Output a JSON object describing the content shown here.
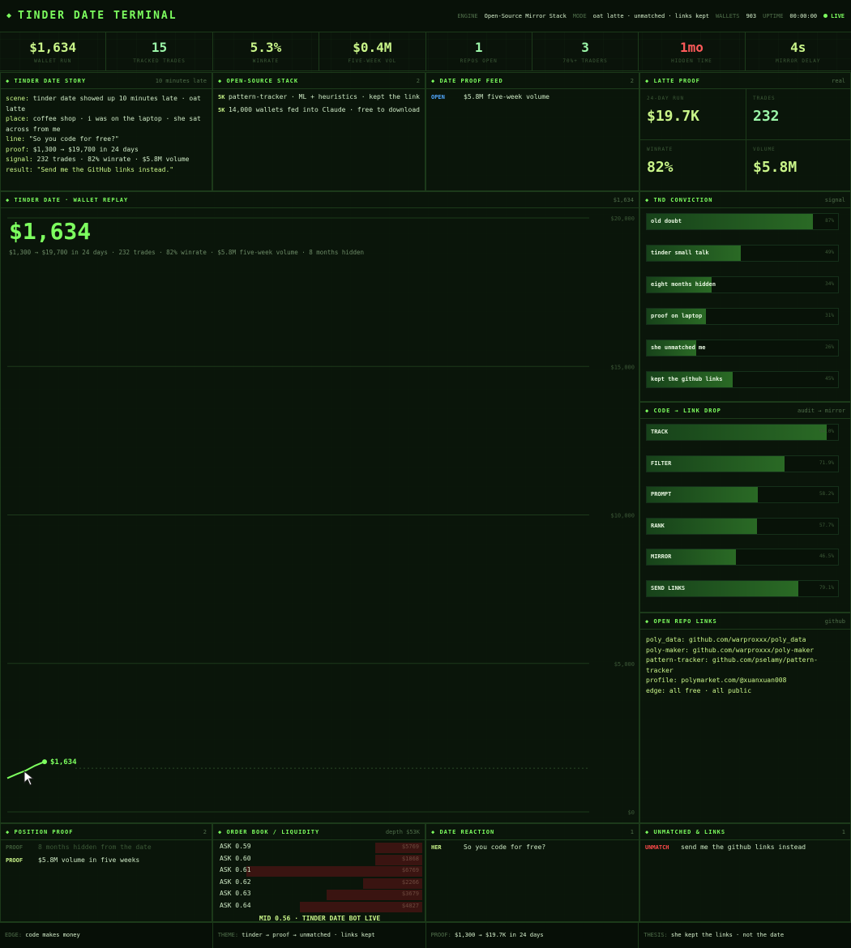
{
  "topbar": {
    "title": "TINDER DATE TERMINAL",
    "engine_label": "ENGINE",
    "engine_value": "Open-Source Mirror Stack",
    "mode_label": "MODE",
    "mode_value": "oat latte · unmatched · links kept",
    "wallets_label": "WALLETS",
    "wallets_value": "903",
    "uptime_label": "UPTIME",
    "uptime_value": "00:00:00",
    "live_label": "LIVE"
  },
  "stats": [
    {
      "value": "$1,634",
      "label": "wallet run",
      "color": "#c9f589"
    },
    {
      "value": "15",
      "label": "tracked trades",
      "color": "#9bf5a8"
    },
    {
      "value": "5.3%",
      "label": "winrate",
      "color": "#c9f589"
    },
    {
      "value": "$0.4M",
      "label": "five-week vol",
      "color": "#c9f589"
    },
    {
      "value": "1",
      "label": "repos open",
      "color": "#9bf5a8"
    },
    {
      "value": "3",
      "label": "70%+ traders",
      "color": "#9bf5a8"
    },
    {
      "value": "1mo",
      "label": "hidden time",
      "color": "#ff5a5a"
    },
    {
      "value": "4s",
      "label": "mirror delay",
      "color": "#c9f589"
    }
  ],
  "story": {
    "title": "TINDER DATE STORY",
    "meta": "10 minutes late",
    "lines": [
      {
        "k": "scene:",
        "v": "tinder date showed up 10 minutes late · oat latte"
      },
      {
        "k": "place:",
        "v": "coffee shop · i was on the laptop · she sat across from me"
      },
      {
        "k": "line:",
        "v": "\"So you code for free?\""
      },
      {
        "k": "proof:",
        "v": "$1,300 → $19,700 in 24 days"
      },
      {
        "k": "signal:",
        "v": "232 trades · 82% winrate · $5.8M volume"
      },
      {
        "k": "result:",
        "v": "\"Send me the GitHub links instead.\""
      }
    ]
  },
  "stack": {
    "title": "OPEN-SOURCE STACK",
    "meta": "2",
    "rows": [
      {
        "tag": "5K",
        "text": "pattern-tracker · ML + heuristics · kept the link"
      },
      {
        "tag": "5K",
        "text": "14,000 wallets fed into Claude · free to download"
      }
    ]
  },
  "feed": {
    "title": "DATE PROOF FEED",
    "meta": "2",
    "rows": [
      {
        "tag": "OPEN",
        "text": "$5.8M five-week volume"
      }
    ]
  },
  "latte": {
    "title": "LATTE PROOF",
    "meta": "real",
    "cells": [
      {
        "label": "24-day run",
        "value": "$19.7K"
      },
      {
        "label": "trades",
        "value": "232"
      },
      {
        "label": "winrate",
        "value": "82%"
      },
      {
        "label": "volume",
        "value": "$5.8M"
      }
    ]
  },
  "replay": {
    "title": "TINDER DATE · WALLET REPLAY",
    "meta": "$1,634",
    "big_value": "$1,634",
    "subline": "$1,300 → $19,700 in 24 days · 232 trades · 82% winrate · $5.8M five-week volume · 8 months hidden",
    "end_label": "$1,634"
  },
  "chart_data": {
    "type": "line",
    "title": "TINDER DATE · WALLET REPLAY",
    "y_ticks": [
      "$20,000",
      "$15,000",
      "$10,000",
      "$5,000",
      "$0"
    ],
    "ylim": [
      0,
      20000
    ],
    "series": [
      {
        "values": [
          1300,
          1380,
          1450,
          1560,
          1634
        ]
      }
    ],
    "grid": true
  },
  "conviction": {
    "title": "TND CONVICTION",
    "meta": "signal",
    "bars": [
      {
        "label": "old doubt",
        "value": 87,
        "pct": "87%"
      },
      {
        "label": "tinder small talk",
        "value": 49,
        "pct": "49%"
      },
      {
        "label": "eight months hidden",
        "value": 34,
        "pct": "34%"
      },
      {
        "label": "proof on laptop",
        "value": 31,
        "pct": "31%"
      },
      {
        "label": "she unmatched me",
        "value": 26,
        "pct": "26%"
      },
      {
        "label": "kept the github links",
        "value": 45,
        "pct": "45%"
      }
    ]
  },
  "linkdrop": {
    "title": "CODE → LINK DROP",
    "meta": "audit → mirror",
    "bars": [
      {
        "label": "TRACK",
        "value": 94.0,
        "pct": "94.0%"
      },
      {
        "label": "FILTER",
        "value": 71.9,
        "pct": "71.9%"
      },
      {
        "label": "PROMPT",
        "value": 58.2,
        "pct": "58.2%"
      },
      {
        "label": "RANK",
        "value": 57.7,
        "pct": "57.7%"
      },
      {
        "label": "MIRROR",
        "value": 46.5,
        "pct": "46.5%"
      },
      {
        "label": "SEND LINKS",
        "value": 79.1,
        "pct": "79.1%"
      }
    ]
  },
  "repos": {
    "title": "OPEN REPO LINKS",
    "meta": "github",
    "lines": [
      "poly_data: github.com/warproxxx/poly_data",
      "poly-maker: github.com/warproxxx/poly-maker",
      "pattern-tracker: github.com/pselamy/pattern-tracker",
      "profile: polymarket.com/@xuanxuan008",
      "edge: all free · all public"
    ]
  },
  "position": {
    "title": "POSITION PROOF",
    "meta": "2",
    "rows": [
      {
        "tag": "PROOF",
        "text": "8 months hidden from the date",
        "dim": true
      },
      {
        "tag": "PROOF",
        "text": "$5.8M volume in five weeks",
        "dim": false
      }
    ]
  },
  "orderbook": {
    "title": "ORDER BOOK / LIQUIDITY",
    "meta": "depth $53K",
    "asks": [
      {
        "label": "ASK 0.59",
        "value": "$5769",
        "depth": 23
      },
      {
        "label": "ASK 0.60",
        "value": "$1868",
        "depth": 23
      },
      {
        "label": "ASK 0.61",
        "value": "$6769",
        "depth": 86
      },
      {
        "label": "ASK 0.62",
        "value": "$2266",
        "depth": 29
      },
      {
        "label": "ASK 0.63",
        "value": "$3679",
        "depth": 47
      },
      {
        "label": "ASK 0.64",
        "value": "$4827",
        "depth": 60
      }
    ],
    "mid": "MID 0.56 · TINDER DATE BOT LIVE"
  },
  "reaction": {
    "title": "DATE REACTION",
    "meta": "1",
    "rows": [
      {
        "tag": "HER",
        "text": "So you code for free?"
      }
    ]
  },
  "unmatched": {
    "title": "UNMATCHED & LINKS",
    "meta": "1",
    "rows": [
      {
        "tag": "UNMATCH",
        "text": "send me the github links instead"
      }
    ]
  },
  "footer": [
    {
      "k": "EDGE:",
      "v": "code makes money"
    },
    {
      "k": "THEME:",
      "v": "tinder → proof → unmatched · links kept"
    },
    {
      "k": "PROOF:",
      "v": "$1,300 → $19.7K in 24 days"
    },
    {
      "k": "THESIS:",
      "v": "she kept the links · not the date"
    }
  ]
}
